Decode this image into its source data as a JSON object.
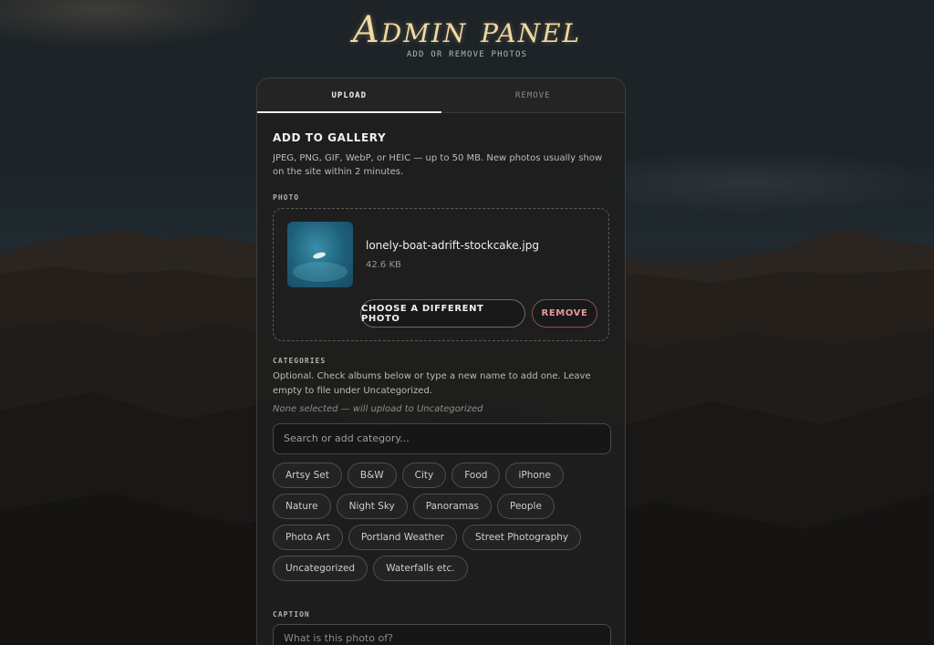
{
  "header": {
    "title": "Admin panel",
    "subtitle": "ADD OR REMOVE PHOTOS"
  },
  "tabs": [
    {
      "label": "UPLOAD",
      "active": true
    },
    {
      "label": "REMOVE",
      "active": false
    }
  ],
  "upload": {
    "section_title": "ADD TO GALLERY",
    "description": "JPEG, PNG, GIF, WebP, or HEIC — up to 50 MB. New photos usually show on the site within 2 minutes.",
    "photo_label": "PHOTO",
    "file": {
      "name": "lonely-boat-adrift-stockcake.jpg",
      "size": "42.6 KB"
    },
    "change_button": "CHOOSE A DIFFERENT PHOTO",
    "remove_button": "REMOVE"
  },
  "categories": {
    "label": "CATEGORIES",
    "description": "Optional. Check albums below or type a new name to add one. Leave empty to file under Uncategorized.",
    "status": "None selected — will upload to Uncategorized",
    "search_placeholder": "Search or add category...",
    "items": [
      "Artsy Set",
      "B&W",
      "City",
      "Food",
      "iPhone",
      "Nature",
      "Night Sky",
      "Panoramas",
      "People",
      "Photo Art",
      "Portland Weather",
      "Street Photography",
      "Uncategorized",
      "Waterfalls etc."
    ]
  },
  "caption": {
    "label": "CAPTION",
    "placeholder": "What is this photo of?"
  },
  "colors": {
    "title": "#f1d9a3",
    "remove_accent": "#e89a9a",
    "tab_underline": "#f0efea"
  }
}
